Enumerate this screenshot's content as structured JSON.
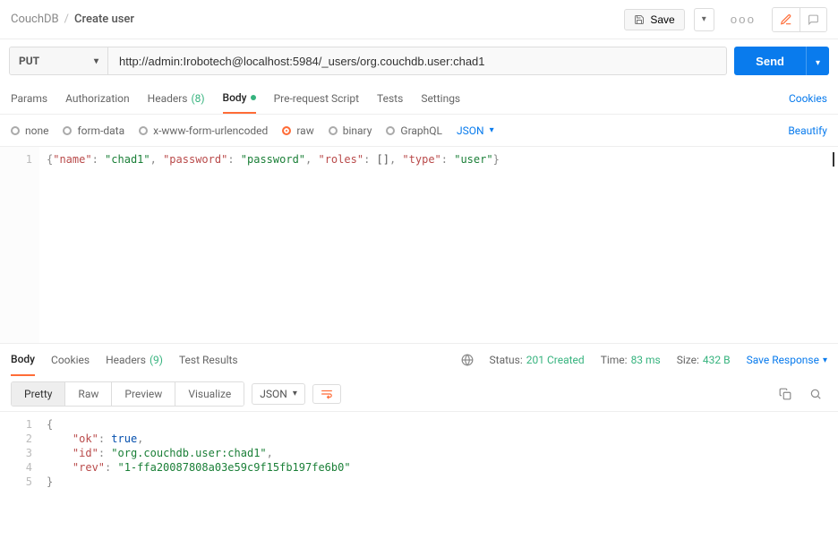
{
  "breadcrumb": {
    "root": "CouchDB",
    "current": "Create user"
  },
  "header": {
    "save_label": "Save"
  },
  "request": {
    "method": "PUT",
    "url": "http://admin:Irobotech@localhost:5984/_users/org.couchdb.user:chad1",
    "send_label": "Send"
  },
  "tabs": {
    "params": "Params",
    "auth": "Authorization",
    "headers": "Headers",
    "headers_count": "(8)",
    "body": "Body",
    "prereq": "Pre-request Script",
    "tests": "Tests",
    "settings": "Settings",
    "cookies": "Cookies"
  },
  "body_types": {
    "none": "none",
    "formdata": "form-data",
    "xwww": "x-www-form-urlencoded",
    "raw": "raw",
    "binary": "binary",
    "graphql": "GraphQL",
    "format": "JSON",
    "beautify": "Beautify"
  },
  "request_body": {
    "raw": "{\"name\": \"chad1\", \"password\": \"password\", \"roles\": [], \"type\": \"user\"}",
    "json": {
      "name": "chad1",
      "password": "password",
      "roles": [],
      "type": "user"
    },
    "line_no": "1"
  },
  "response": {
    "tabs": {
      "body": "Body",
      "cookies": "Cookies",
      "headers": "Headers",
      "headers_count": "(9)",
      "tests": "Test Results"
    },
    "status_label": "Status:",
    "status_value": "201 Created",
    "time_label": "Time:",
    "time_value": "83 ms",
    "size_label": "Size:",
    "size_value": "432 B",
    "save": "Save Response"
  },
  "resp_toolbar": {
    "pretty": "Pretty",
    "raw": "Raw",
    "preview": "Preview",
    "visualize": "Visualize",
    "format": "JSON"
  },
  "response_body": {
    "json": {
      "ok": true,
      "id": "org.couchdb.user:chad1",
      "rev": "1-ffa20087808a03e59c9f15fb197fe6b0"
    },
    "lines": [
      "1",
      "2",
      "3",
      "4",
      "5"
    ]
  }
}
